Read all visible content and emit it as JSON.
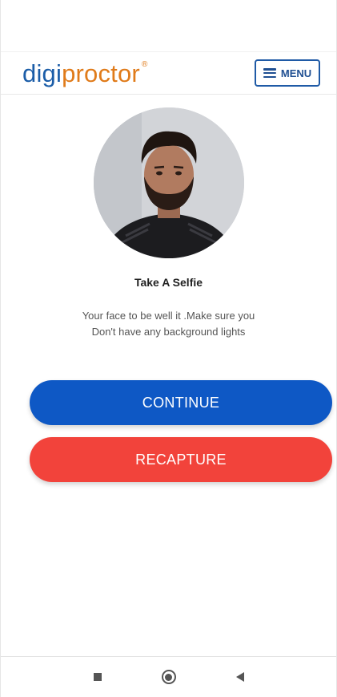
{
  "header": {
    "logo_part1": "digi",
    "logo_part2": "proctor",
    "logo_reg": "®",
    "menu_label": "MENU"
  },
  "selfie": {
    "title": "Take A Selfie",
    "desc_line1": "Your face to be well it .Make sure you",
    "desc_line2": "Don't have any background lights"
  },
  "actions": {
    "continue_label": "CONTINUE",
    "recapture_label": "RECAPTURE"
  },
  "colors": {
    "brand_blue": "#1b5da8",
    "brand_orange": "#e07b1a",
    "continue_bg": "#0e58c5",
    "recapture_bg": "#f2433b"
  },
  "icons": {
    "menu": "hamburger-icon",
    "nav_recents": "square-icon",
    "nav_home": "circle-icon",
    "nav_back": "back-triangle-icon"
  }
}
